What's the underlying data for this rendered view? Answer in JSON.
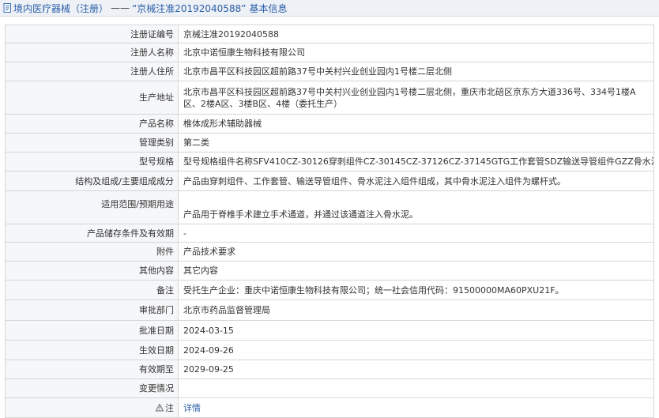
{
  "header": {
    "icon": "document-icon",
    "category": "境内医疗器械（注册）",
    "separator": "——",
    "record_title": "“京械注准20192040588”",
    "section": "基本信息"
  },
  "rows": [
    {
      "label": "注册证编号",
      "value": "京械注准20192040588"
    },
    {
      "label": "注册人名称",
      "value": "北京中诺恒康生物科技有限公司"
    },
    {
      "label": "注册人住所",
      "value": "北京市昌平区科技园区超前路37号中关村兴业创业园内1号楼二层北侧"
    },
    {
      "label": "生产地址",
      "value": "北京市昌平区科技园区超前路37号中关村兴业创业园内1号楼二层北侧，重庆市北碚区京东方大道336号、334号1楼A区、2楼A区、3楼B区、4楼（委托生产）"
    },
    {
      "label": "产品名称",
      "value": "椎体成形术辅助器械"
    },
    {
      "label": "管理类别",
      "value": "第二类"
    },
    {
      "label": "型号规格",
      "value": "型号规格组件名称SFV410CZ-30126穿刺组件CZ-30145CZ-37126CZ-37145GTG工作套管SDZ输送导管组件GZZ骨水泥注入组件"
    },
    {
      "label": "结构及组成/主要组成成分",
      "value": "产品由穿刺组件、工作套管、输送导管组件、骨水泥注入组件组成，其中骨水泥注入组件为螺杆式。"
    },
    {
      "label": "适用范围/预期用途",
      "value": "产品用于脊椎手术建立手术通道，并通过该通道注入骨水泥。"
    },
    {
      "label": "产品储存条件及有效期",
      "value": "-"
    },
    {
      "label": "附件",
      "value": "产品技术要求"
    },
    {
      "label": "其他内容",
      "value": "其它内容"
    },
    {
      "label": "备注",
      "value": "受托生产企业：重庆中诺恒康生物科技有限公司；统一社会信用代码：91500000MA60PXU21F。"
    },
    {
      "label": "审批部门",
      "value": "北京市药品监督管理局"
    },
    {
      "label": "批准日期",
      "value": "2024-03-15"
    },
    {
      "label": "生效日期",
      "value": "2024-09-26"
    },
    {
      "label": "有效期至",
      "value": "2029-09-25"
    },
    {
      "label": "变更情况",
      "value": ""
    },
    {
      "label": "注",
      "value": "详情",
      "icon": "note-icon"
    }
  ]
}
